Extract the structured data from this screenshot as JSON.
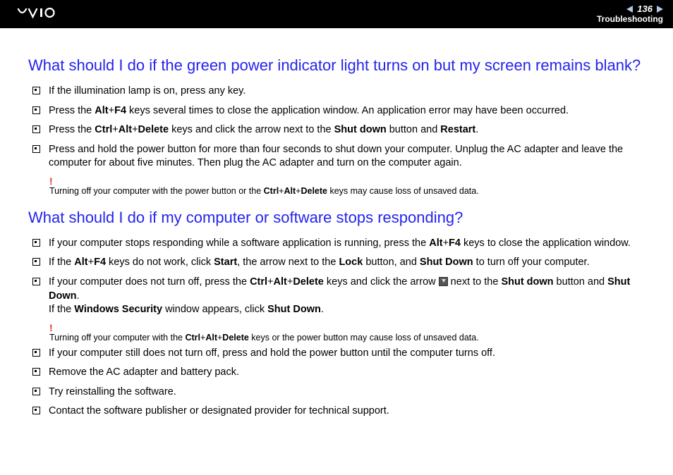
{
  "header": {
    "page_number": "136",
    "section": "Troubleshooting"
  },
  "q1": {
    "title": "What should I do if the green power indicator light turns on but my screen remains blank?",
    "items": [
      {
        "t": "If the illumination lamp is on, press any key."
      },
      {
        "pre": "Press the ",
        "b1": "Alt",
        "mid1": "+",
        "b2": "F4",
        "post": " keys several times to close the application window. An application error may have been occurred."
      },
      {
        "pre": "Press the ",
        "b1": "Ctrl",
        "mid1": "+",
        "b2": "Alt",
        "mid2": "+",
        "b3": "Delete",
        "post1": " keys and click the arrow next to the ",
        "b4": "Shut down",
        "post2": " button and ",
        "b5": "Restart",
        "post3": "."
      },
      {
        "t": "Press and hold the power button for more than four seconds to shut down your computer. Unplug the AC adapter and leave the computer for about five minutes. Then plug the AC adapter and turn on the computer again."
      }
    ],
    "warning": {
      "pre": "Turning off your computer with the power button or the ",
      "b1": "Ctrl",
      "mid1": "+",
      "b2": "Alt",
      "mid2": "+",
      "b3": "Delete",
      "post": " keys may cause loss of unsaved data."
    }
  },
  "q2": {
    "title": "What should I do if my computer or software stops responding?",
    "items": [
      {
        "pre": "If your computer stops responding while a software application is running, press the ",
        "b1": "Alt",
        "mid1": "+",
        "b2": "F4",
        "post": " keys to close the application window."
      },
      {
        "pre": "If the ",
        "b1": "Alt",
        "mid1": "+",
        "b2": "F4",
        "post1": " keys do not work, click ",
        "b3": "Start",
        "post2": ", the arrow next to the ",
        "b4": "Lock",
        "post3": " button, and ",
        "b5": "Shut Down",
        "post4": " to turn off your computer."
      },
      {
        "pre": "If your computer does not turn off, press the ",
        "b1": "Ctrl",
        "mid1": "+",
        "b2": "Alt",
        "mid2": "+",
        "b3": "Delete",
        "post1": " keys and click the arrow ",
        "post2": " next to the ",
        "b4": "Shut down",
        "post3": " button and ",
        "b5": "Shut Down",
        "post4": ".",
        "line2_pre": "If the ",
        "line2_b1": "Windows Security",
        "line2_post1": " window appears, click ",
        "line2_b2": "Shut Down",
        "line2_post2": "."
      }
    ],
    "warning": {
      "pre": "Turning off your computer with the ",
      "b1": "Ctrl",
      "mid1": "+",
      "b2": "Alt",
      "mid2": "+",
      "b3": "Delete",
      "post": " keys or the power button may cause loss of unsaved data."
    },
    "items2": [
      {
        "t": "If your computer still does not turn off, press and hold the power button until the computer turns off."
      },
      {
        "t": "Remove the AC adapter and battery pack."
      },
      {
        "t": "Try reinstalling the software."
      },
      {
        "t": "Contact the software publisher or designated provider for technical support."
      }
    ]
  }
}
